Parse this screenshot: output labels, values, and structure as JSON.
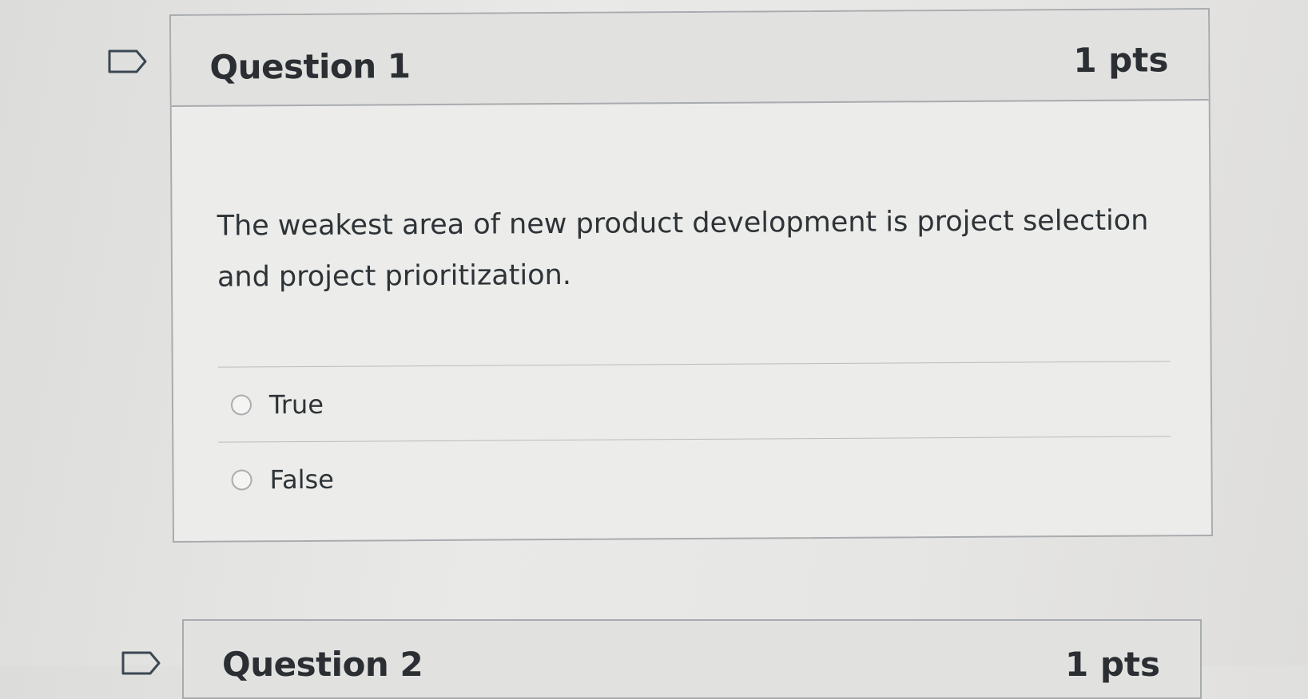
{
  "question1": {
    "title": "Question 1",
    "points": "1 pts",
    "text": "The weakest area of new product development is project selection and project prioritization.",
    "answers": [
      {
        "label": "True"
      },
      {
        "label": "False"
      }
    ]
  },
  "question2": {
    "title": "Question 2",
    "points": "1 pts"
  },
  "icons": {
    "flag": "flag-outline-icon",
    "radio": "radio-unchecked-icon"
  },
  "colors": {
    "border": "#a8acae",
    "header_bg": "#e1e1df",
    "text": "#2d3337"
  }
}
